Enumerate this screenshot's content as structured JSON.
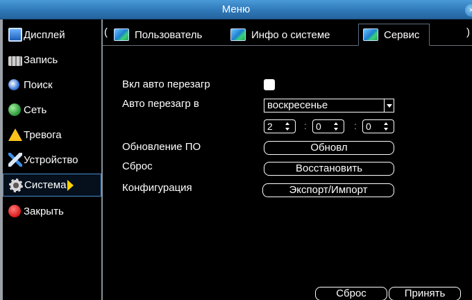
{
  "window": {
    "title": "Меню",
    "close_icon": "close-icon"
  },
  "sidebar": {
    "items": [
      {
        "label": "Дисплей",
        "icon": "display-icon"
      },
      {
        "label": "Запись",
        "icon": "record-icon"
      },
      {
        "label": "Поиск",
        "icon": "search-icon"
      },
      {
        "label": "Сеть",
        "icon": "network-icon"
      },
      {
        "label": "Тревога",
        "icon": "alarm-icon"
      },
      {
        "label": "Устройство",
        "icon": "device-icon"
      },
      {
        "label": "Система",
        "icon": "system-gear-icon",
        "active": true
      },
      {
        "label": "Закрыть",
        "icon": "power-icon"
      }
    ]
  },
  "tabs": {
    "prev": "(",
    "next": ")",
    "items": [
      {
        "label": "Пользователь"
      },
      {
        "label": "Инфо о системе"
      },
      {
        "label": "Сервис",
        "active": true
      }
    ]
  },
  "service": {
    "auto_reboot_label": "Вкл авто перезагр",
    "auto_reboot_checked": false,
    "reboot_at_label": "Авто перезагр в",
    "reboot_day": "воскресенье",
    "hour": "2",
    "minute": "0",
    "second": "0",
    "time_sep": ":",
    "update_label": "Обновление ПО",
    "update_button": "Обновл",
    "reset_label": "Сброс",
    "restore_button": "Восстановить",
    "config_label": "Конфигурация",
    "export_button": "Экспорт/Импорт"
  },
  "footer": {
    "reset_button": "Сброс",
    "apply_button": "Принять"
  },
  "colors": {
    "title_bar": "#2f78b8",
    "background": "#000000",
    "accent": "#ffd200",
    "active_border": "#4a8fd0"
  }
}
